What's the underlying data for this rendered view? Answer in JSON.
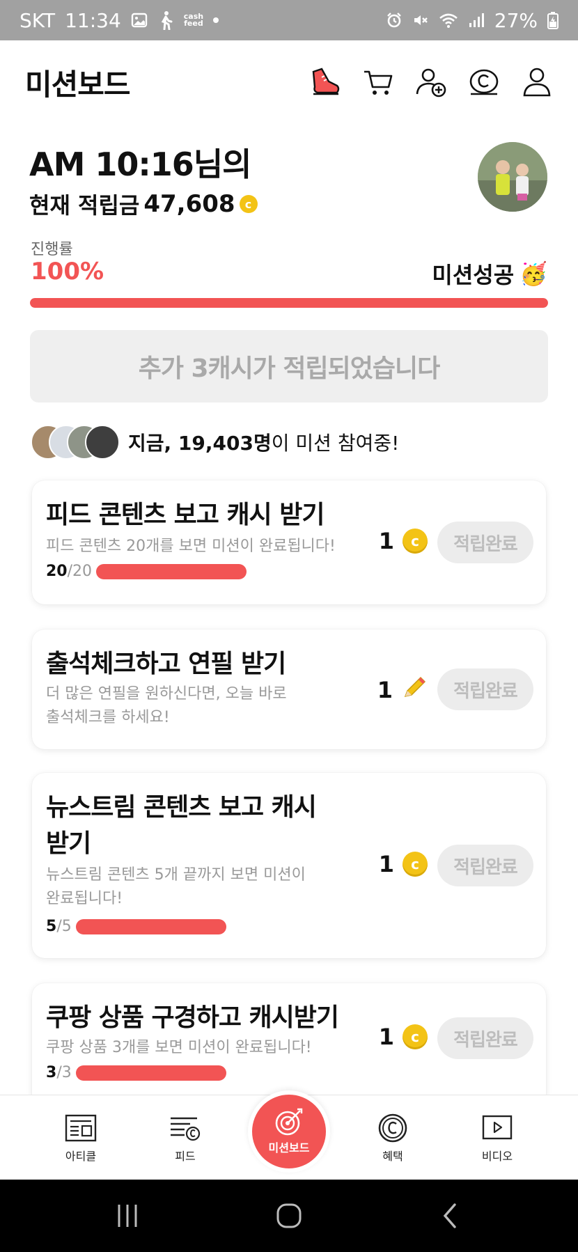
{
  "status_bar": {
    "carrier": "SKT",
    "time": "11:34",
    "cashfeed_label_top": "cash",
    "cashfeed_label_bottom": "feed",
    "battery": "27%"
  },
  "header": {
    "title": "미션보드",
    "icons": [
      "sneaker-icon",
      "cart-icon",
      "add-friend-icon",
      "coin-c-icon",
      "profile-icon"
    ]
  },
  "user": {
    "greeting": "AM 10:16님의",
    "balance_label": "현재 적립금",
    "balance_value": "47,608"
  },
  "progress": {
    "label": "진행률",
    "percent_text": "100%",
    "fraction": 1.0,
    "status": "미션성공",
    "status_emoji": "🥳"
  },
  "notice": {
    "text": "추가 3캐시가 적립되었습니다"
  },
  "participants": {
    "prefix": "지금,",
    "count": "19,403명",
    "suffix": "이 미션 참여중!"
  },
  "missions": [
    {
      "title": "피드 콘텐츠 보고 캐시 받기",
      "desc": "피드 콘텐츠 20개를 보면 미션이 완료됩니다!",
      "done": "20",
      "total": "/20",
      "reward": "1",
      "reward_icon": "coin-icon",
      "button": "적립완료"
    },
    {
      "title": "출석체크하고 연필 받기",
      "desc_line1": "더 많은 연필을 원하신다면, 오늘 바로",
      "desc_line2": "출석체크를 하세요!",
      "reward": "1",
      "reward_icon": "pencil-icon",
      "button": "적립완료"
    },
    {
      "title_line1": "뉴스트림 콘텐츠 보고 캐시",
      "title_line2": "받기",
      "desc_line1": "뉴스트림 콘텐츠 5개 끝까지 보면 미션이",
      "desc_line2": "완료됩니다!",
      "done": "5",
      "total": "/5",
      "reward": "1",
      "reward_icon": "coin-icon",
      "button": "적립완료"
    },
    {
      "title": "쿠팡 상품 구경하고 캐시받기",
      "desc": "쿠팡 상품 3개를 보면 미션이 완료됩니다!",
      "done": "3",
      "total": "/3",
      "reward": "1",
      "reward_icon": "coin-icon",
      "button": "적립완료"
    }
  ],
  "bottom_nav": {
    "article": "아티클",
    "feed": "피드",
    "missionboard": "미션보드",
    "benefit": "혜택",
    "video": "비디오"
  },
  "colors": {
    "accent": "#f25454",
    "coin": "#f3c316",
    "status_bar": "#a1a1a1"
  }
}
